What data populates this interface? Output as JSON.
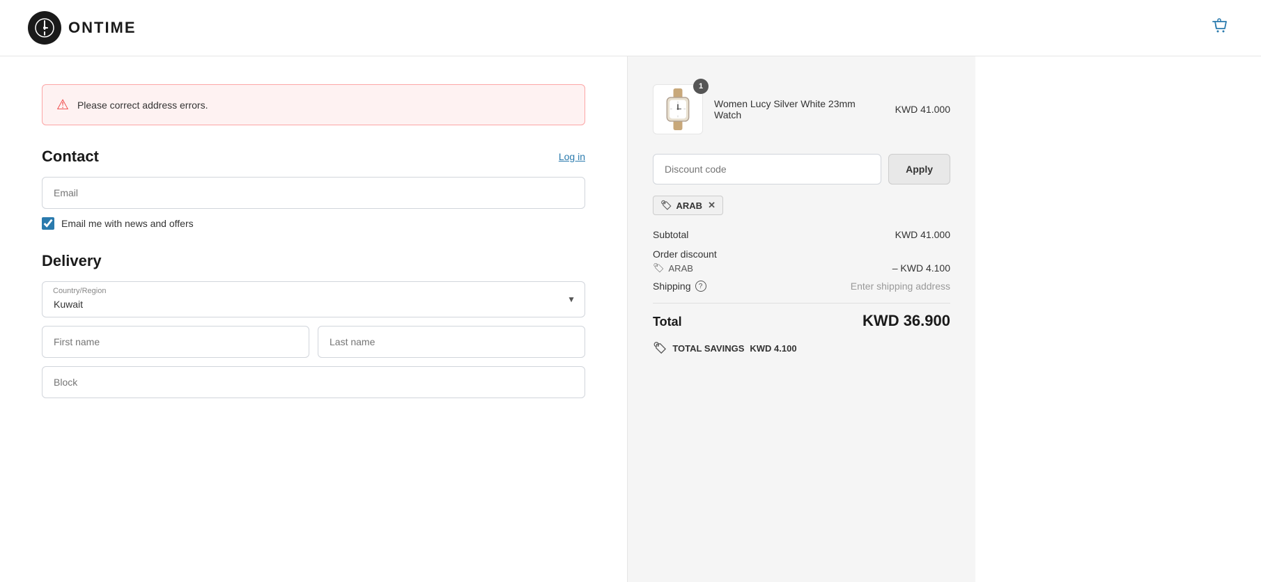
{
  "header": {
    "logo_text": "ONTIME",
    "cart_icon": "shopping-bag-icon"
  },
  "error": {
    "message": "Please correct address errors."
  },
  "contact": {
    "title": "Contact",
    "log_in_label": "Log in",
    "email_placeholder": "Email",
    "checkbox_label": "Email me with news and offers",
    "checkbox_checked": true
  },
  "delivery": {
    "title": "Delivery",
    "country_label": "Country/Region",
    "country_value": "Kuwait",
    "first_name_placeholder": "First name",
    "last_name_placeholder": "Last name",
    "block_placeholder": "Block"
  },
  "order_summary": {
    "product": {
      "name": "Women Lucy Silver White 23mm Watch",
      "price": "KWD 41.000",
      "badge": "1"
    },
    "discount_code_placeholder": "Discount code",
    "apply_label": "Apply",
    "coupon_code": "ARAB",
    "subtotal_label": "Subtotal",
    "subtotal_value": "KWD 41.000",
    "order_discount_label": "Order discount",
    "discount_code_tag": "ARAB",
    "discount_value": "– KWD 4.100",
    "shipping_label": "Shipping",
    "shipping_value": "Enter shipping address",
    "total_label": "Total",
    "total_value": "KWD 36.900",
    "savings_label": "TOTAL SAVINGS",
    "savings_value": "KWD 4.100"
  }
}
